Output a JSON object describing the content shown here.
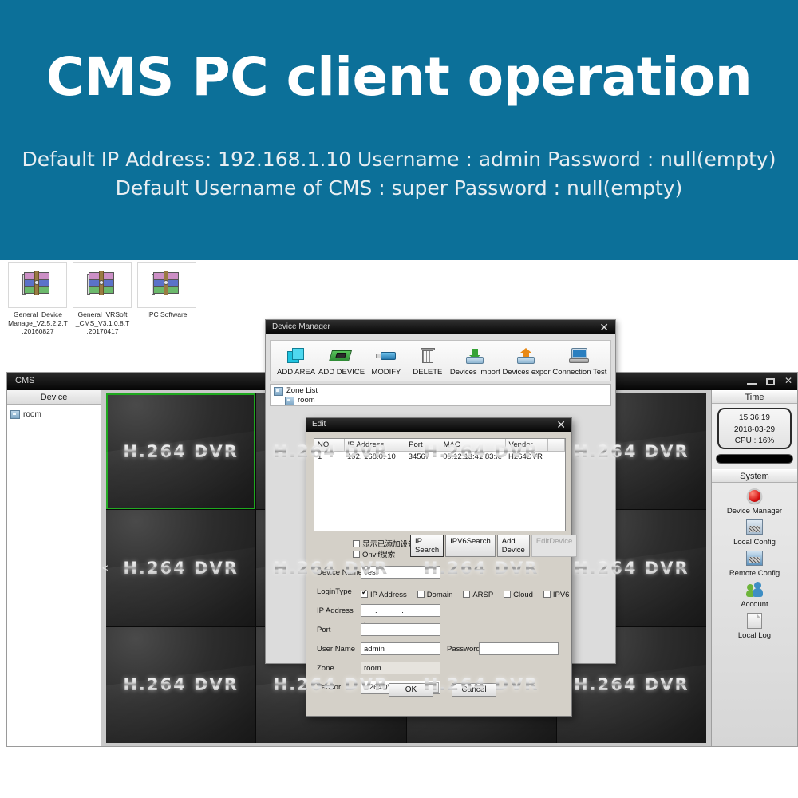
{
  "banner": {
    "title": "CMS PC client operation",
    "line1": "Default IP Address: 192.168.1.10 Username : admin Password : null(empty)",
    "line2": "Default Username of CMS : super Password : null(empty)"
  },
  "desktop_icons": [
    {
      "name": "General_Device Manage_V2.5.2.2.T.20160827",
      "icon": "winrar-archive-icon"
    },
    {
      "name": "General_VRSoft _CMS_V3.1.0.8.T .20170417",
      "icon": "winrar-archive-icon"
    },
    {
      "name": "IPC Software",
      "icon": "winrar-archive-icon"
    }
  ],
  "cms_window": {
    "title": "CMS",
    "device_panel": {
      "header": "Device",
      "tree": [
        {
          "label": "room"
        }
      ]
    },
    "video": {
      "cell_label": "H.264 DVR",
      "rows": 3,
      "cols": 4,
      "selected_index": 0,
      "collapse_arrow": "<"
    },
    "system_panel": {
      "time_header": "Time",
      "time": "15:36:19",
      "date": "2018-03-29",
      "cpu": "CPU : 16%",
      "system_header": "System",
      "items": [
        {
          "label": "Device Manager",
          "icon": "red-button-icon"
        },
        {
          "label": "Local Config",
          "icon": "local-config-icon"
        },
        {
          "label": "Remote Config",
          "icon": "remote-config-icon"
        },
        {
          "label": "Account",
          "icon": "users-icon"
        },
        {
          "label": "Local Log",
          "icon": "document-icon"
        }
      ]
    },
    "window_controls": {
      "minimize": "minimize-icon",
      "maximize": "maximize-icon",
      "close": "✕"
    }
  },
  "device_manager": {
    "title": "Device Manager",
    "close": "✕",
    "toolbar": [
      {
        "label": "ADD AREA",
        "icon": "add-area-icon"
      },
      {
        "label": "ADD DEVICE",
        "icon": "add-device-icon"
      },
      {
        "label": "MODIFY",
        "icon": "modify-icon"
      },
      {
        "label": "DELETE",
        "icon": "trash-icon"
      },
      {
        "label": "Devices import",
        "icon": "devices-import-icon"
      },
      {
        "label": "Devices expor",
        "icon": "devices-export-icon"
      },
      {
        "label": "Connection Test",
        "icon": "connection-test-icon"
      }
    ],
    "zone_list": {
      "root": "Zone List",
      "child": "room"
    }
  },
  "edit_dialog": {
    "title": "Edit",
    "close": "✕",
    "table": {
      "headers": [
        "NO.",
        "IP Address",
        "Port",
        "MAC",
        "Vendor",
        ""
      ],
      "rows": [
        [
          "1",
          "192. 168.0. 10",
          "34567",
          "00:12:13:41:83:fe",
          "H264DVR",
          ""
        ]
      ]
    },
    "search_row": {
      "show_added_devices": "显示已添加设备",
      "onvif_search": "Onvif搜索",
      "show_added_checked": false,
      "onvif_checked": false,
      "buttons": [
        {
          "label": "IP Search",
          "state": "primary"
        },
        {
          "label": "IPV6Search",
          "state": "normal"
        },
        {
          "label": "Add Device",
          "state": "normal"
        },
        {
          "label": "EditDevice",
          "state": "disabled"
        }
      ]
    },
    "fields": {
      "device_name_label": "Device Name",
      "device_name_value": "Test",
      "login_type_label": "LoginType",
      "login_types": [
        {
          "label": "IP Address",
          "checked": true
        },
        {
          "label": "Domain",
          "checked": false
        },
        {
          "label": "ARSP",
          "checked": false
        },
        {
          "label": "Cloud",
          "checked": false
        },
        {
          "label": "IPV6",
          "checked": false
        }
      ],
      "ip_address_label": "IP Address",
      "ip_address_value": ".    .    .",
      "port_label": "Port",
      "port_value": "",
      "user_name_label": "User Name",
      "user_name_value": "admin",
      "password_label": "Password",
      "password_value": "",
      "zone_label": "Zone",
      "zone_value": "room",
      "vendor_label": "Vendor",
      "vendor_value": "H264DVR"
    },
    "ok_label": "OK",
    "cancel_label": "Cancel"
  },
  "colors": {
    "banner_bg": "#0c7099",
    "selection_green": "#1ea81e",
    "dialog_face": "#d4d0c8"
  }
}
